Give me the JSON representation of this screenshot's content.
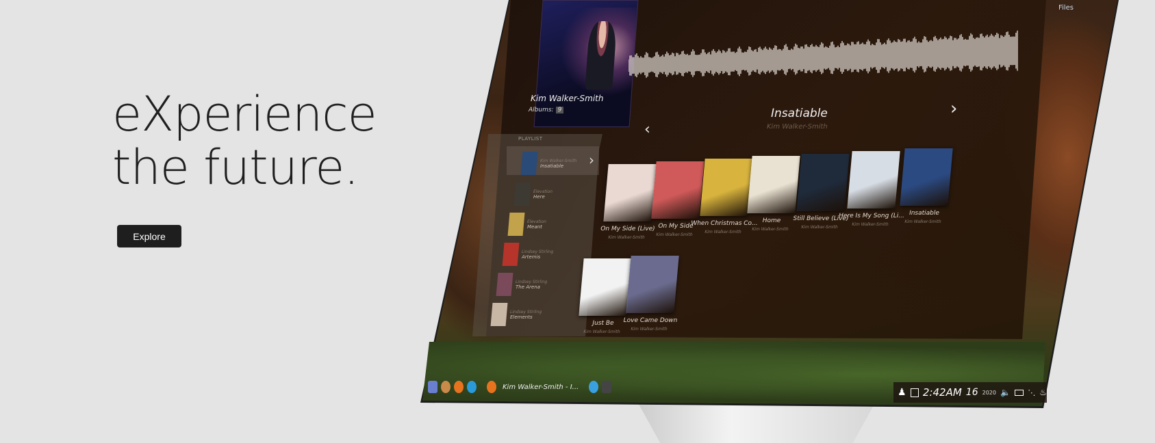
{
  "hero": {
    "line1": "eXperience",
    "line2": "the future.",
    "cta": "Explore"
  },
  "player": {
    "artist_card": {
      "name": "Kim Walker-Smith",
      "albums_label": "Albums:",
      "albums_count": "9"
    },
    "now_playing": {
      "title": "Insatiable",
      "artist": "Kim Walker-Smith"
    },
    "playlist": {
      "header": "PLAYLIST",
      "items": [
        {
          "sub": "Kim Walker-Smith",
          "title": "Insatiable",
          "color": "#2a4a78"
        },
        {
          "sub": "Elevation",
          "title": "Here",
          "color": "#3d3a34"
        },
        {
          "sub": "Elevation",
          "title": "Meant",
          "color": "#c2a24a"
        },
        {
          "sub": "Lindsey Stirling",
          "title": "Artemis",
          "color": "#b6342a"
        },
        {
          "sub": "Lindsey Stirling",
          "title": "The Arena",
          "color": "#7a4a5a"
        },
        {
          "sub": "Lindsey Stirling",
          "title": "Elements",
          "color": "#c9b7a6"
        }
      ]
    },
    "albums": [
      {
        "title": "On My Side (Live)",
        "artist": "Kim Walker-Smith",
        "color": "#e9d9d2"
      },
      {
        "title": "On My Side",
        "artist": "Kim Walker-Smith",
        "color": "#d05a5a"
      },
      {
        "title": "When Christmas Co...",
        "artist": "Kim Walker-Smith",
        "color": "#d8b43e"
      },
      {
        "title": "Home",
        "artist": "Kim Walker-Smith",
        "color": "#e9e2d2"
      },
      {
        "title": "Still Believe (Live)",
        "artist": "Kim Walker-Smith",
        "color": "#1f2a3a"
      },
      {
        "title": "Here Is My Song (Li...",
        "artist": "Kim Walker-Smith",
        "color": "#d7dde4"
      },
      {
        "title": "Insatiable",
        "artist": "Kim Walker-Smith",
        "color": "#2b4a82"
      },
      {
        "title": "Just Be",
        "artist": "Kim Walker-Smith",
        "color": "#f2f2f2"
      },
      {
        "title": "Love Came Down",
        "artist": "Kim Walker-Smith",
        "color": "#6a6b8e"
      }
    ]
  },
  "taskbar": {
    "window_title": "Kim Walker-Smith - I...",
    "clock": "2:42AM",
    "date_day": "16",
    "date_year": "2020",
    "desktop_label": "Files"
  },
  "icons": [
    "user-icon",
    "window-icon",
    "speaker-icon",
    "battery-icon",
    "network-icon",
    "bell-icon",
    "chevron-left-icon",
    "chevron-right-icon"
  ]
}
